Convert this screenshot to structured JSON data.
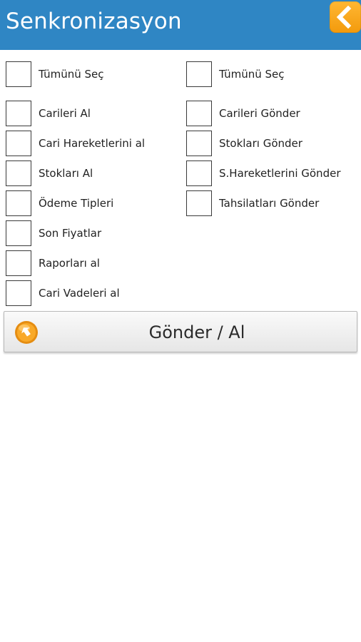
{
  "header": {
    "title": "Senkronizasyon",
    "back_icon": "chevron-left-icon",
    "accent_color": "#2f86c4",
    "back_button_color": "#f7a51d"
  },
  "left_column": {
    "select_all": "Tümünü Seç",
    "items": [
      "Carileri Al",
      "Cari Hareketlerini al",
      "Stokları Al",
      "Ödeme Tipleri",
      "Son Fiyatlar",
      "Raporları al",
      "Cari Vadeleri al"
    ]
  },
  "right_column": {
    "select_all": "Tümünü Seç",
    "items": [
      "Carileri Gönder",
      "Stokları Gönder",
      "S.Hareketlerini Gönder",
      "Tahsilatları Gönder"
    ]
  },
  "action": {
    "label": "Gönder / Al",
    "icon": "sync-icon"
  }
}
